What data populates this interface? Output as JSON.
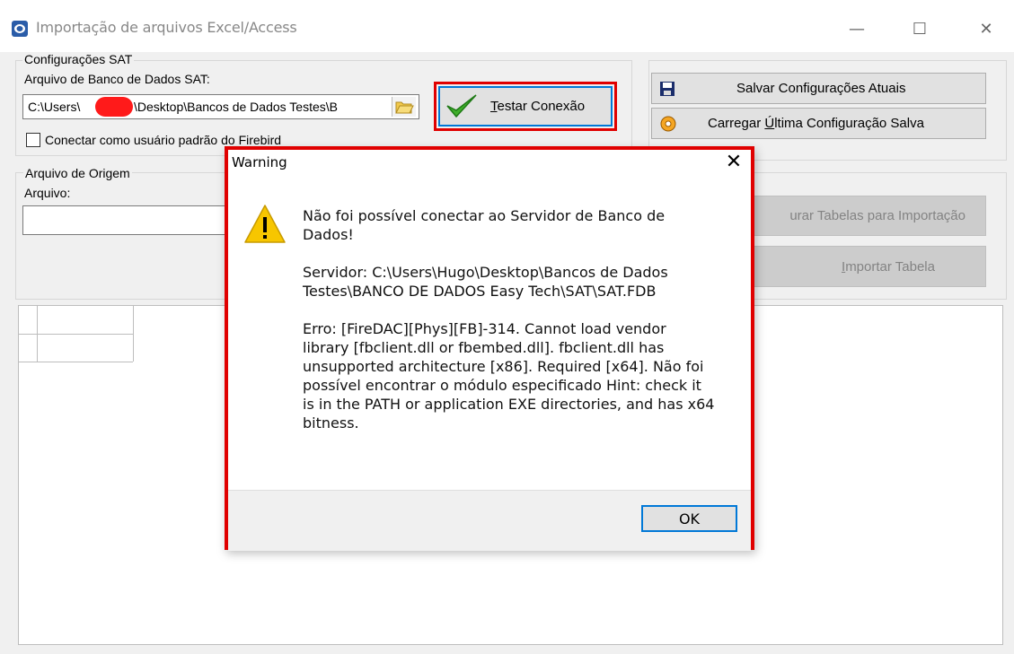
{
  "window": {
    "title": "Importação de arquivos Excel/Access",
    "minimize_glyph": "—",
    "maximize_glyph": "☐",
    "close_glyph": "✕"
  },
  "sat_config": {
    "group_label": "Configurações SAT",
    "db_label": "Arquivo de Banco de Dados SAT:",
    "db_path_start": "C:\\Users\\",
    "db_path_end": "\\Desktop\\Bancos de Dados Testes\\B",
    "test_button": "Testar Conexão",
    "test_button_hotkey": "T",
    "test_button_rest": "estar Conexão",
    "firebird_checkbox": "Conectar como usuário padrão do Firebird"
  },
  "config_buttons": {
    "save": "Salvar Configurações Atuais",
    "load_hotkey": "Ú",
    "load_pre": "Carregar ",
    "load_rest": "ltima Configuração Salva"
  },
  "origin": {
    "group_label": "Arquivo de Origem",
    "file_label": "Arquivo:",
    "file_value": "",
    "search_tables_button": "urar Tabelas para Importação",
    "import_button_hotkey": "I",
    "import_button_rest": "mportar Tabela"
  },
  "dialog": {
    "title": "Warning",
    "close_glyph": "✕",
    "message_line1": "Não foi possível conectar ao Servidor de Banco de Dados!",
    "message_server": "Servidor: C:\\Users\\Hugo\\Desktop\\Bancos de Dados Testes\\BANCO DE DADOS Easy Tech\\SAT\\SAT.FDB",
    "message_error": "Erro: [FireDAC][Phys][FB]-314. Cannot load vendor library [fbclient.dll or fbembed.dll]. fbclient.dll has unsupported architecture [x86]. Required [x64]. Não foi possível encontrar o módulo especificado Hint: check it is in the PATH or application EXE directories, and has x64 bitness.",
    "ok_button": "OK"
  },
  "colors": {
    "highlight_red": "#e00000",
    "focus_blue": "#0078d7",
    "warning_yellow": "#f7c600"
  }
}
